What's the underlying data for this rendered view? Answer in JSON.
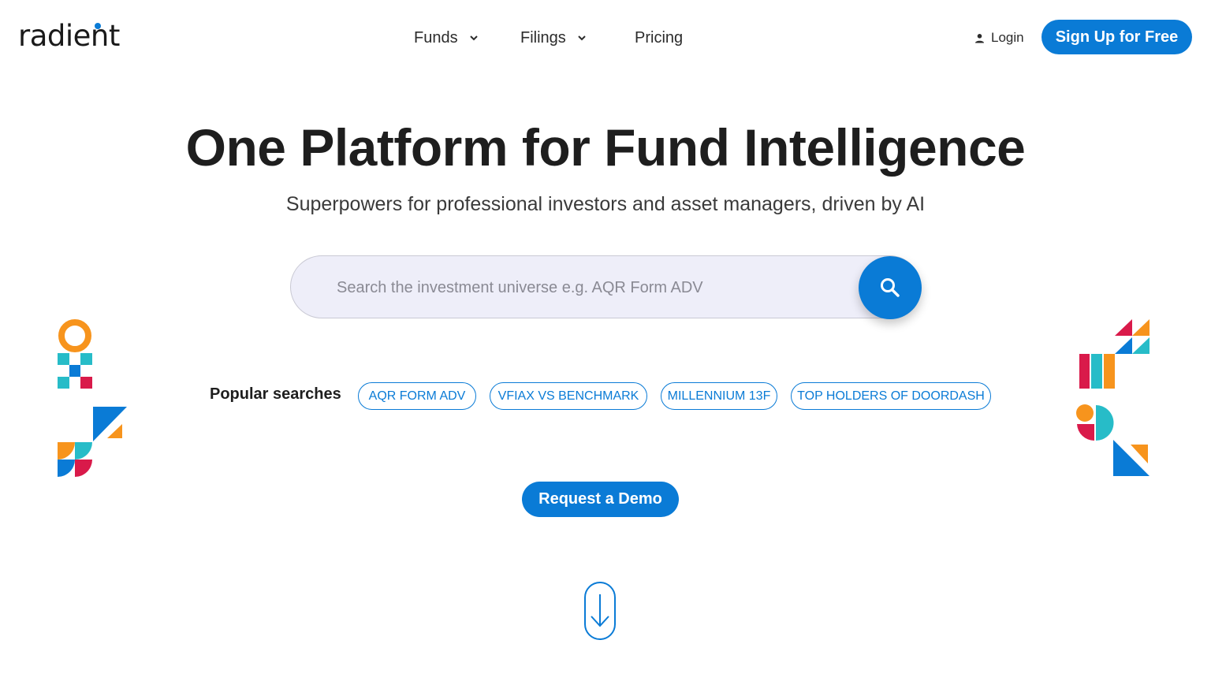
{
  "brand": {
    "logo_text": "radient"
  },
  "nav": {
    "items": [
      {
        "label": "Funds",
        "has_dropdown": true
      },
      {
        "label": "Filings",
        "has_dropdown": true
      },
      {
        "label": "Pricing",
        "has_dropdown": false
      }
    ],
    "login_label": "Login",
    "signup_label": "Sign Up for Free"
  },
  "hero": {
    "title": "One Platform for Fund Intelligence",
    "subtitle": "Superpowers for professional investors and asset managers, driven by AI"
  },
  "search": {
    "placeholder": "Search the investment universe e.g. AQR Form ADV",
    "value": ""
  },
  "popular": {
    "label": "Popular searches",
    "chips": [
      "AQR FORM ADV",
      "VFIAX VS BENCHMARK",
      "MILLENNIUM 13F",
      "TOP HOLDERS OF DOORDASH"
    ]
  },
  "cta": {
    "demo_label": "Request a Demo"
  },
  "icons": {
    "search": "search-icon",
    "login": "person-icon",
    "dropdown": "chevron-down-icon",
    "scroll": "arrow-down-icon"
  },
  "colors": {
    "accent": "#0a7bd6",
    "orange": "#f7941d",
    "teal": "#27bcc8",
    "crimson": "#d91a4a",
    "text": "#1e1e1e"
  }
}
